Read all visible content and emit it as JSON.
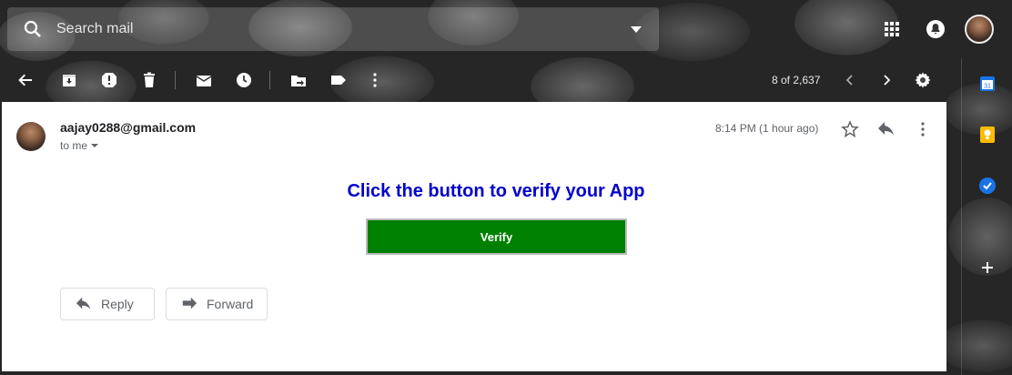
{
  "header": {
    "search": {
      "placeholder": "Search mail"
    }
  },
  "toolbar": {
    "pager": "8 of 2,637"
  },
  "email": {
    "sender": "aajay0288@gmail.com",
    "recipient": "to me",
    "time": "8:14 PM (1 hour ago)",
    "headline": "Click the button to verify your App",
    "verify_label": "Verify"
  },
  "actions": {
    "reply_label": "Reply",
    "forward_label": "Forward"
  },
  "side_panel": {
    "calendar_day": "31"
  },
  "colors": {
    "headline": "#0000cd",
    "verify_button": "#008000",
    "calendar": "#1a73e8",
    "keep": "#fbbc04",
    "tasks": "#1a73e8"
  }
}
